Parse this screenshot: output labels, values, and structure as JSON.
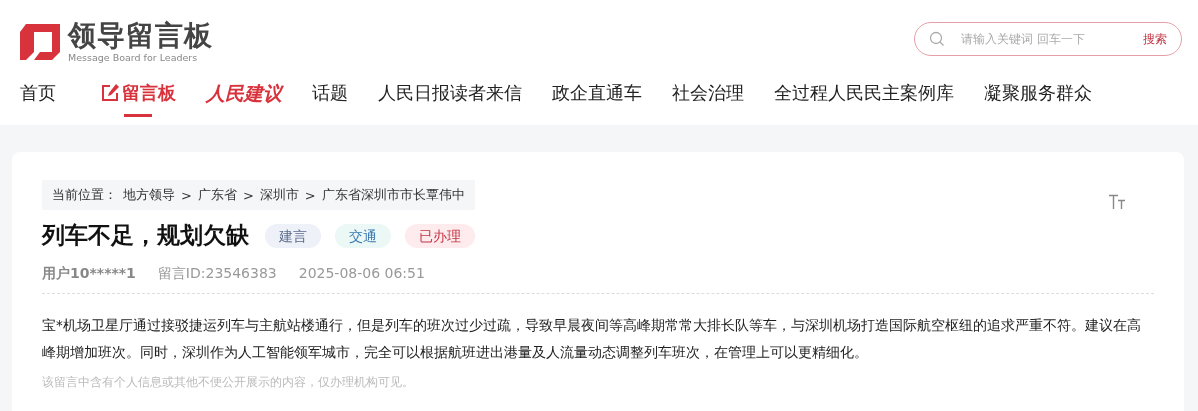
{
  "logo": {
    "title": "领导留言板",
    "subtitle": "Message Board for Leaders"
  },
  "search": {
    "placeholder": "请输入关键词 回车一下",
    "button": "搜索"
  },
  "nav": [
    {
      "label": "首页",
      "kind": "plain",
      "selected": false
    },
    {
      "label": "留言板",
      "kind": "board",
      "selected": true
    },
    {
      "label": "人民建议",
      "kind": "proposal",
      "selected": false
    },
    {
      "label": "话题",
      "kind": "plain",
      "selected": false
    },
    {
      "label": "人民日报读者来信",
      "kind": "plain",
      "selected": false
    },
    {
      "label": "政企直通车",
      "kind": "plain",
      "selected": false
    },
    {
      "label": "社会治理",
      "kind": "plain",
      "selected": false
    },
    {
      "label": "全过程人民民主案例库",
      "kind": "plain",
      "selected": false
    },
    {
      "label": "凝聚服务群众",
      "kind": "plain",
      "selected": false
    }
  ],
  "breadcrumb": {
    "prefix": "当前位置：",
    "items": [
      "地方领导",
      "广东省",
      "深圳市",
      "广东省深圳市市长覃伟中"
    ],
    "separator": ">"
  },
  "message": {
    "title": "列车不足，规划欠缺",
    "tags": [
      {
        "label": "建言",
        "kind": "category",
        "color": "#eef1f7"
      },
      {
        "label": "交通",
        "kind": "field",
        "color": "#ecf8f6"
      },
      {
        "label": "已办理",
        "kind": "status",
        "color": "#fdebed"
      }
    ],
    "user": "用户10*****1",
    "id": "留言ID:23546383",
    "time": "2025-08-06 06:51",
    "body": "宝*机场卫星厅通过接驳捷运列车与主航站楼通行，但是列车的班次过少过疏，导致早晨夜间等高峰期常常大排长队等车，与深圳机场打造国际航空枢纽的追求严重不符。建议在高峰期增加班次。同时，深圳作为人工智能领军城市，完全可以根据航班进出港量及人流量动态调整列车班次，在管理上可以更精细化。",
    "note": "该留言中含有个人信息或其他不便公开展示的内容，仅办理机构可见。"
  }
}
